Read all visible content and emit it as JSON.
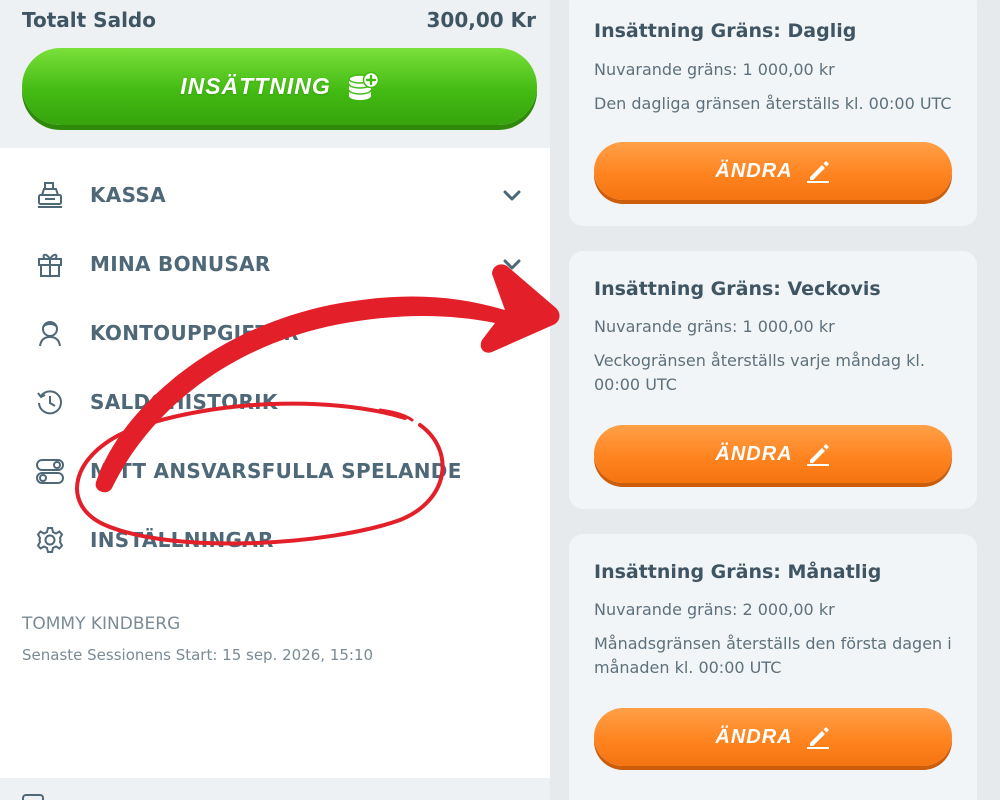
{
  "balance": {
    "label": "Totalt Saldo",
    "amount": "300,00 Kr"
  },
  "deposit": {
    "label": "INSÄTTNING",
    "icon": "coin-stack-plus-icon"
  },
  "menu": [
    {
      "label": "KASSA",
      "icon": "cash-register-icon",
      "has_chevron": true
    },
    {
      "label": "MINA BONUSAR",
      "icon": "gift-icon",
      "has_chevron": true
    },
    {
      "label": "KONTOUPPGIFTER",
      "icon": "user-icon",
      "has_chevron": true
    },
    {
      "label": "SALDOHISTORIK",
      "icon": "history-icon",
      "has_chevron": false
    },
    {
      "label": "MITT ANSVARSFULLA SPELANDE",
      "icon": "toggles-icon",
      "has_chevron": false
    },
    {
      "label": "INSTÄLLNINGAR",
      "icon": "gear-icon",
      "has_chevron": false
    }
  ],
  "user": {
    "name": "TOMMY KINDBERG",
    "session": "Senaste Sessionens Start: 15 sep. 2026, 15:10"
  },
  "limits": [
    {
      "title": "Insättning Gräns: Daglig",
      "current": "Nuvarande gräns: 1 000,00 kr",
      "note": "Den dagliga gränsen återställs kl. 00:00 UTC",
      "button": "ÄNDRA"
    },
    {
      "title": "Insättning Gräns: Veckovis",
      "current": "Nuvarande gräns: 1 000,00 kr",
      "note": "Veckogränsen återställs varje måndag kl. 00:00 UTC",
      "button": "ÄNDRA"
    },
    {
      "title": "Insättning Gräns: Månatlig",
      "current": "Nuvarande gräns: 2 000,00 kr",
      "note": "Månadsgränsen återställs den första dagen i månaden kl. 00:00 UTC",
      "button": "ÄNDRA"
    }
  ],
  "colors": {
    "deposit_green": "#43bb13",
    "change_orange": "#ff8420",
    "annotation_red": "#e3202a",
    "text": "#3f5563"
  }
}
